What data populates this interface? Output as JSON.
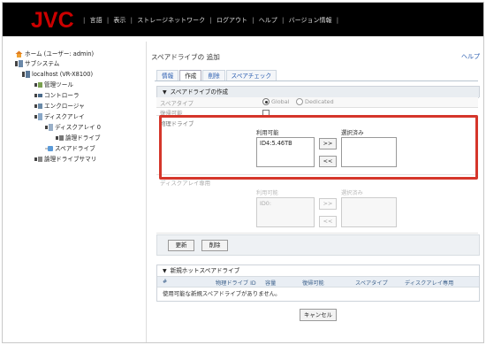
{
  "brand": {
    "logo_text": "JVC",
    "logo_color": "#cc0000"
  },
  "topnav": {
    "items": [
      "言語",
      "表示",
      "ストレージネットワーク",
      "ログアウト",
      "ヘルプ",
      "バージョン情報"
    ]
  },
  "tree": [
    {
      "label": "ホーム (ユーザー: admin)",
      "icon": "home-icon"
    },
    {
      "label": "サブシステム",
      "icon": "subsystem-icon"
    },
    {
      "label": "localhost (VR-X8100)",
      "icon": "server-icon"
    },
    {
      "label": "管理ツール",
      "icon": "tool-icon"
    },
    {
      "label": "コントローラ",
      "icon": "controller-icon"
    },
    {
      "label": "エンクロージャ",
      "icon": "enclosure-icon"
    },
    {
      "label": "ディスクアレイ",
      "icon": "disk-array-icon"
    },
    {
      "label": "ディスクアレイ 0",
      "icon": "disk-icon"
    },
    {
      "label": "論理ドライブ",
      "icon": "logical-drive-icon"
    },
    {
      "label": "スペアドライブ",
      "icon": "spare-drive-icon"
    },
    {
      "label": "論理ドライブサマリ",
      "icon": "summary-icon"
    }
  ],
  "page": {
    "title": "スペアドライブの 追加",
    "help": "ヘルプ"
  },
  "tabs": [
    "情報",
    "作成",
    "削除",
    "スペアチェック"
  ],
  "create_section": {
    "header": "スペアドライブの作成",
    "spare_type_label": "スペアタイプ",
    "radio_global": "Global",
    "radio_dedicated": "Dedicated",
    "revertible_label": "復帰可能"
  },
  "physical": {
    "label": "物理ドライブ",
    "available_label": "利用可能",
    "selected_label": "選択済み",
    "available_items": [
      "ID4:5.46TB"
    ],
    "add_btn": ">>",
    "remove_btn": "<<"
  },
  "disk_array_only": {
    "label": "ディスクアレイ専用",
    "available_label": "利用可能",
    "selected_label": "選択済み",
    "available_items": [
      "ID0:"
    ],
    "add_btn": ">>",
    "remove_btn": "<<"
  },
  "actions": {
    "update": "更新",
    "delete": "削除",
    "cancel": "キャンセル"
  },
  "new_hot_spare": {
    "header": "新規ホットスペアドライブ",
    "columns": [
      "#",
      "物理ドライブ ID",
      "容量",
      "復帰可能",
      "スペアタイプ",
      "ディスクアレイ専用"
    ],
    "empty_message": "使用可能な新規スペアドライブがありません。"
  }
}
